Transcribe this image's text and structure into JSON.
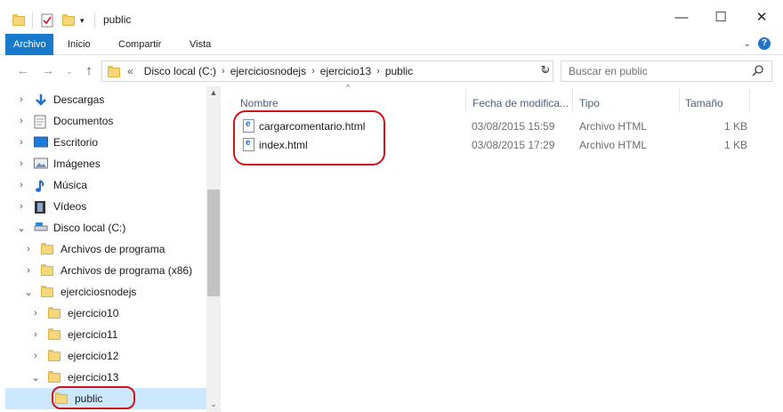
{
  "window": {
    "title": "public",
    "controls": [
      "minimize",
      "maximize",
      "close"
    ]
  },
  "ribbon": {
    "tabs": [
      "Archivo",
      "Inicio",
      "Compartir",
      "Vista"
    ],
    "active_tab": "Archivo",
    "help_label": "?"
  },
  "address": {
    "overflow": "«",
    "segments": [
      "Disco local (C:)",
      "ejerciciosnodejs",
      "ejercicio13",
      "public"
    ]
  },
  "search": {
    "placeholder": "Buscar en public"
  },
  "navpane": {
    "items": [
      {
        "label": "Descargas",
        "icon": "download-arrow-icon",
        "expander": "›"
      },
      {
        "label": "Documentos",
        "icon": "document-icon",
        "expander": "›"
      },
      {
        "label": "Escritorio",
        "icon": "desktop-icon",
        "expander": "›"
      },
      {
        "label": "Imágenes",
        "icon": "pictures-icon",
        "expander": "›"
      },
      {
        "label": "Música",
        "icon": "music-note-icon",
        "expander": "›"
      },
      {
        "label": "Vídeos",
        "icon": "film-strip-icon",
        "expander": "›"
      },
      {
        "label": "Disco local (C:)",
        "icon": "drive-icon",
        "expander": "⌄"
      },
      {
        "label": "Archivos de programa",
        "icon": "folder-icon",
        "expander": "›"
      },
      {
        "label": "Archivos de programa (x86)",
        "icon": "folder-icon",
        "expander": "›"
      },
      {
        "label": "ejerciciosnodejs",
        "icon": "folder-icon",
        "expander": "⌄"
      },
      {
        "label": "ejercicio10",
        "icon": "folder-icon",
        "expander": "›"
      },
      {
        "label": "ejercicio11",
        "icon": "folder-icon",
        "expander": "›"
      },
      {
        "label": "ejercicio12",
        "icon": "folder-icon",
        "expander": "›"
      },
      {
        "label": "ejercicio13",
        "icon": "folder-icon",
        "expander": "⌄"
      },
      {
        "label": "public",
        "icon": "folder-icon",
        "expander": ""
      }
    ],
    "selected": "public"
  },
  "table": {
    "columns": [
      "Nombre",
      "Fecha de modifica...",
      "Tipo",
      "Tamaño"
    ],
    "rows": [
      {
        "name": "cargarcomentario.html",
        "date": "03/08/2015 15:59",
        "type": "Archivo HTML",
        "size": "1 KB"
      },
      {
        "name": "index.html",
        "date": "03/08/2015 17:29",
        "type": "Archivo HTML",
        "size": "1 KB"
      }
    ]
  },
  "colors": {
    "accent": "#1979ca",
    "selection": "#cce8ff",
    "annotation": "#d0121a"
  }
}
